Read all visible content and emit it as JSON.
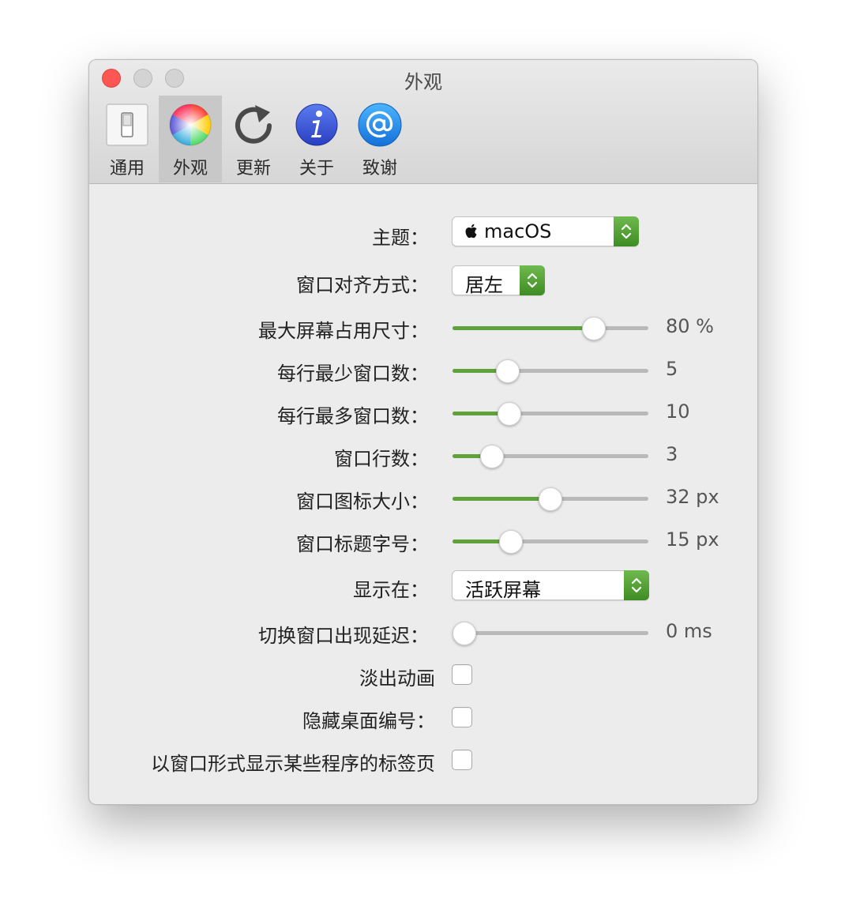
{
  "window": {
    "title": "外观"
  },
  "toolbar": {
    "items": [
      {
        "label": "通用",
        "icon": "switch-icon"
      },
      {
        "label": "外观",
        "icon": "color-wheel-icon",
        "selected": true
      },
      {
        "label": "更新",
        "icon": "refresh-icon"
      },
      {
        "label": "关于",
        "icon": "info-icon"
      },
      {
        "label": "致谢",
        "icon": "at-sign-icon"
      }
    ]
  },
  "settings": {
    "theme": {
      "label": "主题：",
      "value": "macOS",
      "icon": "apple-logo-icon"
    },
    "alignment": {
      "label": "窗口对齐方式：",
      "value": "居左"
    },
    "max_screen_size": {
      "label": "最大屏幕占用尺寸：",
      "value_text": "80 %",
      "level": 0.75
    },
    "min_windows_per_row": {
      "label": "每行最少窗口数：",
      "value_text": "5",
      "level": 0.25
    },
    "max_windows_per_row": {
      "label": "每行最多窗口数：",
      "value_text": "10",
      "level": 0.26
    },
    "window_rows": {
      "label": "窗口行数：",
      "value_text": "3",
      "level": 0.16
    },
    "window_icon_size": {
      "label": "窗口图标大小：",
      "value_text": "32 px",
      "level": 0.5
    },
    "window_title_font_size": {
      "label": "窗口标题字号：",
      "value_text": "15 px",
      "level": 0.27
    },
    "show_on": {
      "label": "显示在：",
      "value": "活跃屏幕"
    },
    "switch_delay": {
      "label": "切换窗口出现延迟：",
      "value_text": "0 ms",
      "level": 0.0
    },
    "fade_animation": {
      "label": "淡出动画",
      "checked": false
    },
    "hide_desktop_number": {
      "label": "隐藏桌面编号：",
      "checked": false
    },
    "show_tabs_as_windows": {
      "label": "以窗口形式显示某些程序的标签页",
      "checked": false
    }
  },
  "colors": {
    "accent": "#5ea239",
    "close": "#fc5753"
  }
}
